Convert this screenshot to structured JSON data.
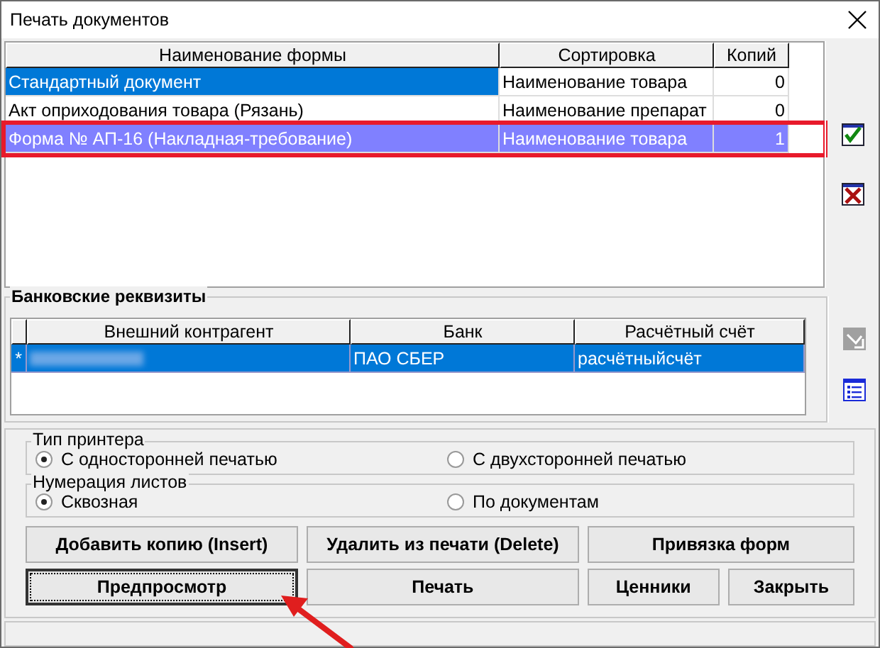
{
  "window": {
    "title": "Печать документов"
  },
  "forms_table": {
    "columns": [
      "Наименование формы",
      "Сортировка",
      "Копий"
    ],
    "rows": [
      {
        "cells": [
          "Стандартный документ",
          "Наименование товара",
          "0"
        ],
        "selected": true,
        "highlighted": false
      },
      {
        "cells": [
          "Акт оприходования товара (Рязань)",
          "Наименование препарат",
          "0"
        ],
        "selected": false,
        "highlighted": false
      },
      {
        "cells": [
          "Форма № АП-16 (Накладная-требование)",
          "Наименование товара",
          "1"
        ],
        "selected": false,
        "highlighted": true
      }
    ]
  },
  "forms_toolbar": [
    {
      "kind": "check",
      "disabled": false
    },
    {
      "kind": "cross",
      "disabled": false
    }
  ],
  "bank_details": {
    "title": "Банковские реквизиты",
    "columns": [
      "Внешний контрагент",
      "Банк",
      "Расчётный счёт"
    ],
    "rows": [
      {
        "marker": "*",
        "cells": [
          {
            "redacted": true
          },
          {
            "text": "ПАО СБЕР"
          },
          {
            "text": "расчётныйсчёт"
          }
        ],
        "selected": true
      }
    ]
  },
  "bank_toolbar": [
    {
      "kind": "edit",
      "disabled": true
    },
    {
      "kind": "list",
      "disabled": false
    }
  ],
  "printer_type": {
    "title": "Тип принтера",
    "options": [
      {
        "label": "С односторонней печатью",
        "selected": true
      },
      {
        "label": "С двухсторонней печатью",
        "selected": false
      }
    ]
  },
  "page_numbering": {
    "title": "Нумерация листов",
    "options": [
      {
        "label": "Сквозная",
        "selected": true
      },
      {
        "label": "По документам",
        "selected": false
      }
    ]
  },
  "buttons": [
    [
      {
        "label": "Добавить копию (Insert)",
        "focused": false
      },
      {
        "label": "Удалить из печати (Delete)",
        "focused": false
      },
      {
        "label": "Привязка форм",
        "focused": false
      }
    ],
    [
      {
        "label": "Предпросмотр",
        "focused": true
      },
      {
        "label": "Печать",
        "focused": false
      },
      {
        "label": "Ценники",
        "focused": false
      },
      {
        "label": "Закрыть",
        "focused": false
      }
    ]
  ],
  "annotation": {
    "kind": "arrow"
  }
}
